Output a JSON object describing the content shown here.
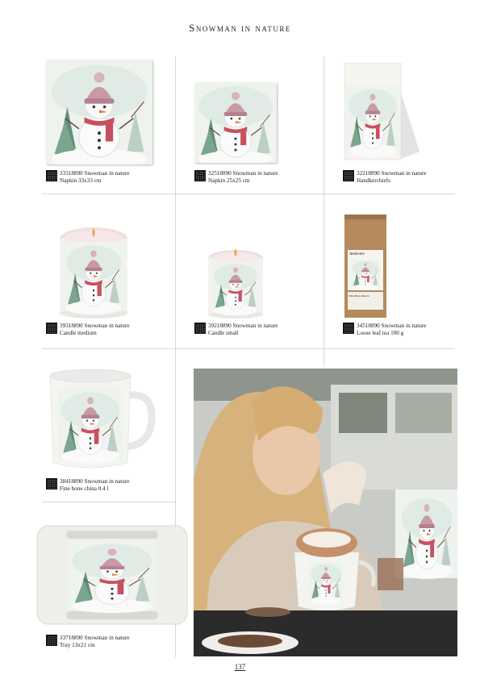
{
  "title": "Snowman in nature",
  "page_number": "137",
  "products": [
    {
      "code_line": "33318890 Snowman in nature",
      "desc": "Napkin 33x33 cm"
    },
    {
      "code_line": "32518890 Snowman in nature",
      "desc": "Napkin 25x25 cm"
    },
    {
      "code_line": "32218890 Snowman in nature",
      "desc": "Handkerchiefs"
    },
    {
      "code_line": "39318890 Snowman in nature",
      "desc": "Candle medium"
    },
    {
      "code_line": "39218890 Snowman in nature",
      "desc": "Candle small"
    },
    {
      "code_line": "34518890 Snowman in nature",
      "desc": "Loose leaf tea 100 g"
    },
    {
      "code_line": "38418890 Snowman in nature",
      "desc": "Fine bone china 0.4 l"
    },
    {
      "code_line": "33718890 Snowman in nature",
      "desc": "Tray 13x21 cm"
    }
  ],
  "tea_bag": {
    "brand": "Ambiente",
    "label": "Wild Berry Punch"
  },
  "colors": {
    "scarf": "#c9505e",
    "hat": "#c79aa6",
    "tree": "#5f8f7a",
    "sky": "#dfe9e4"
  }
}
